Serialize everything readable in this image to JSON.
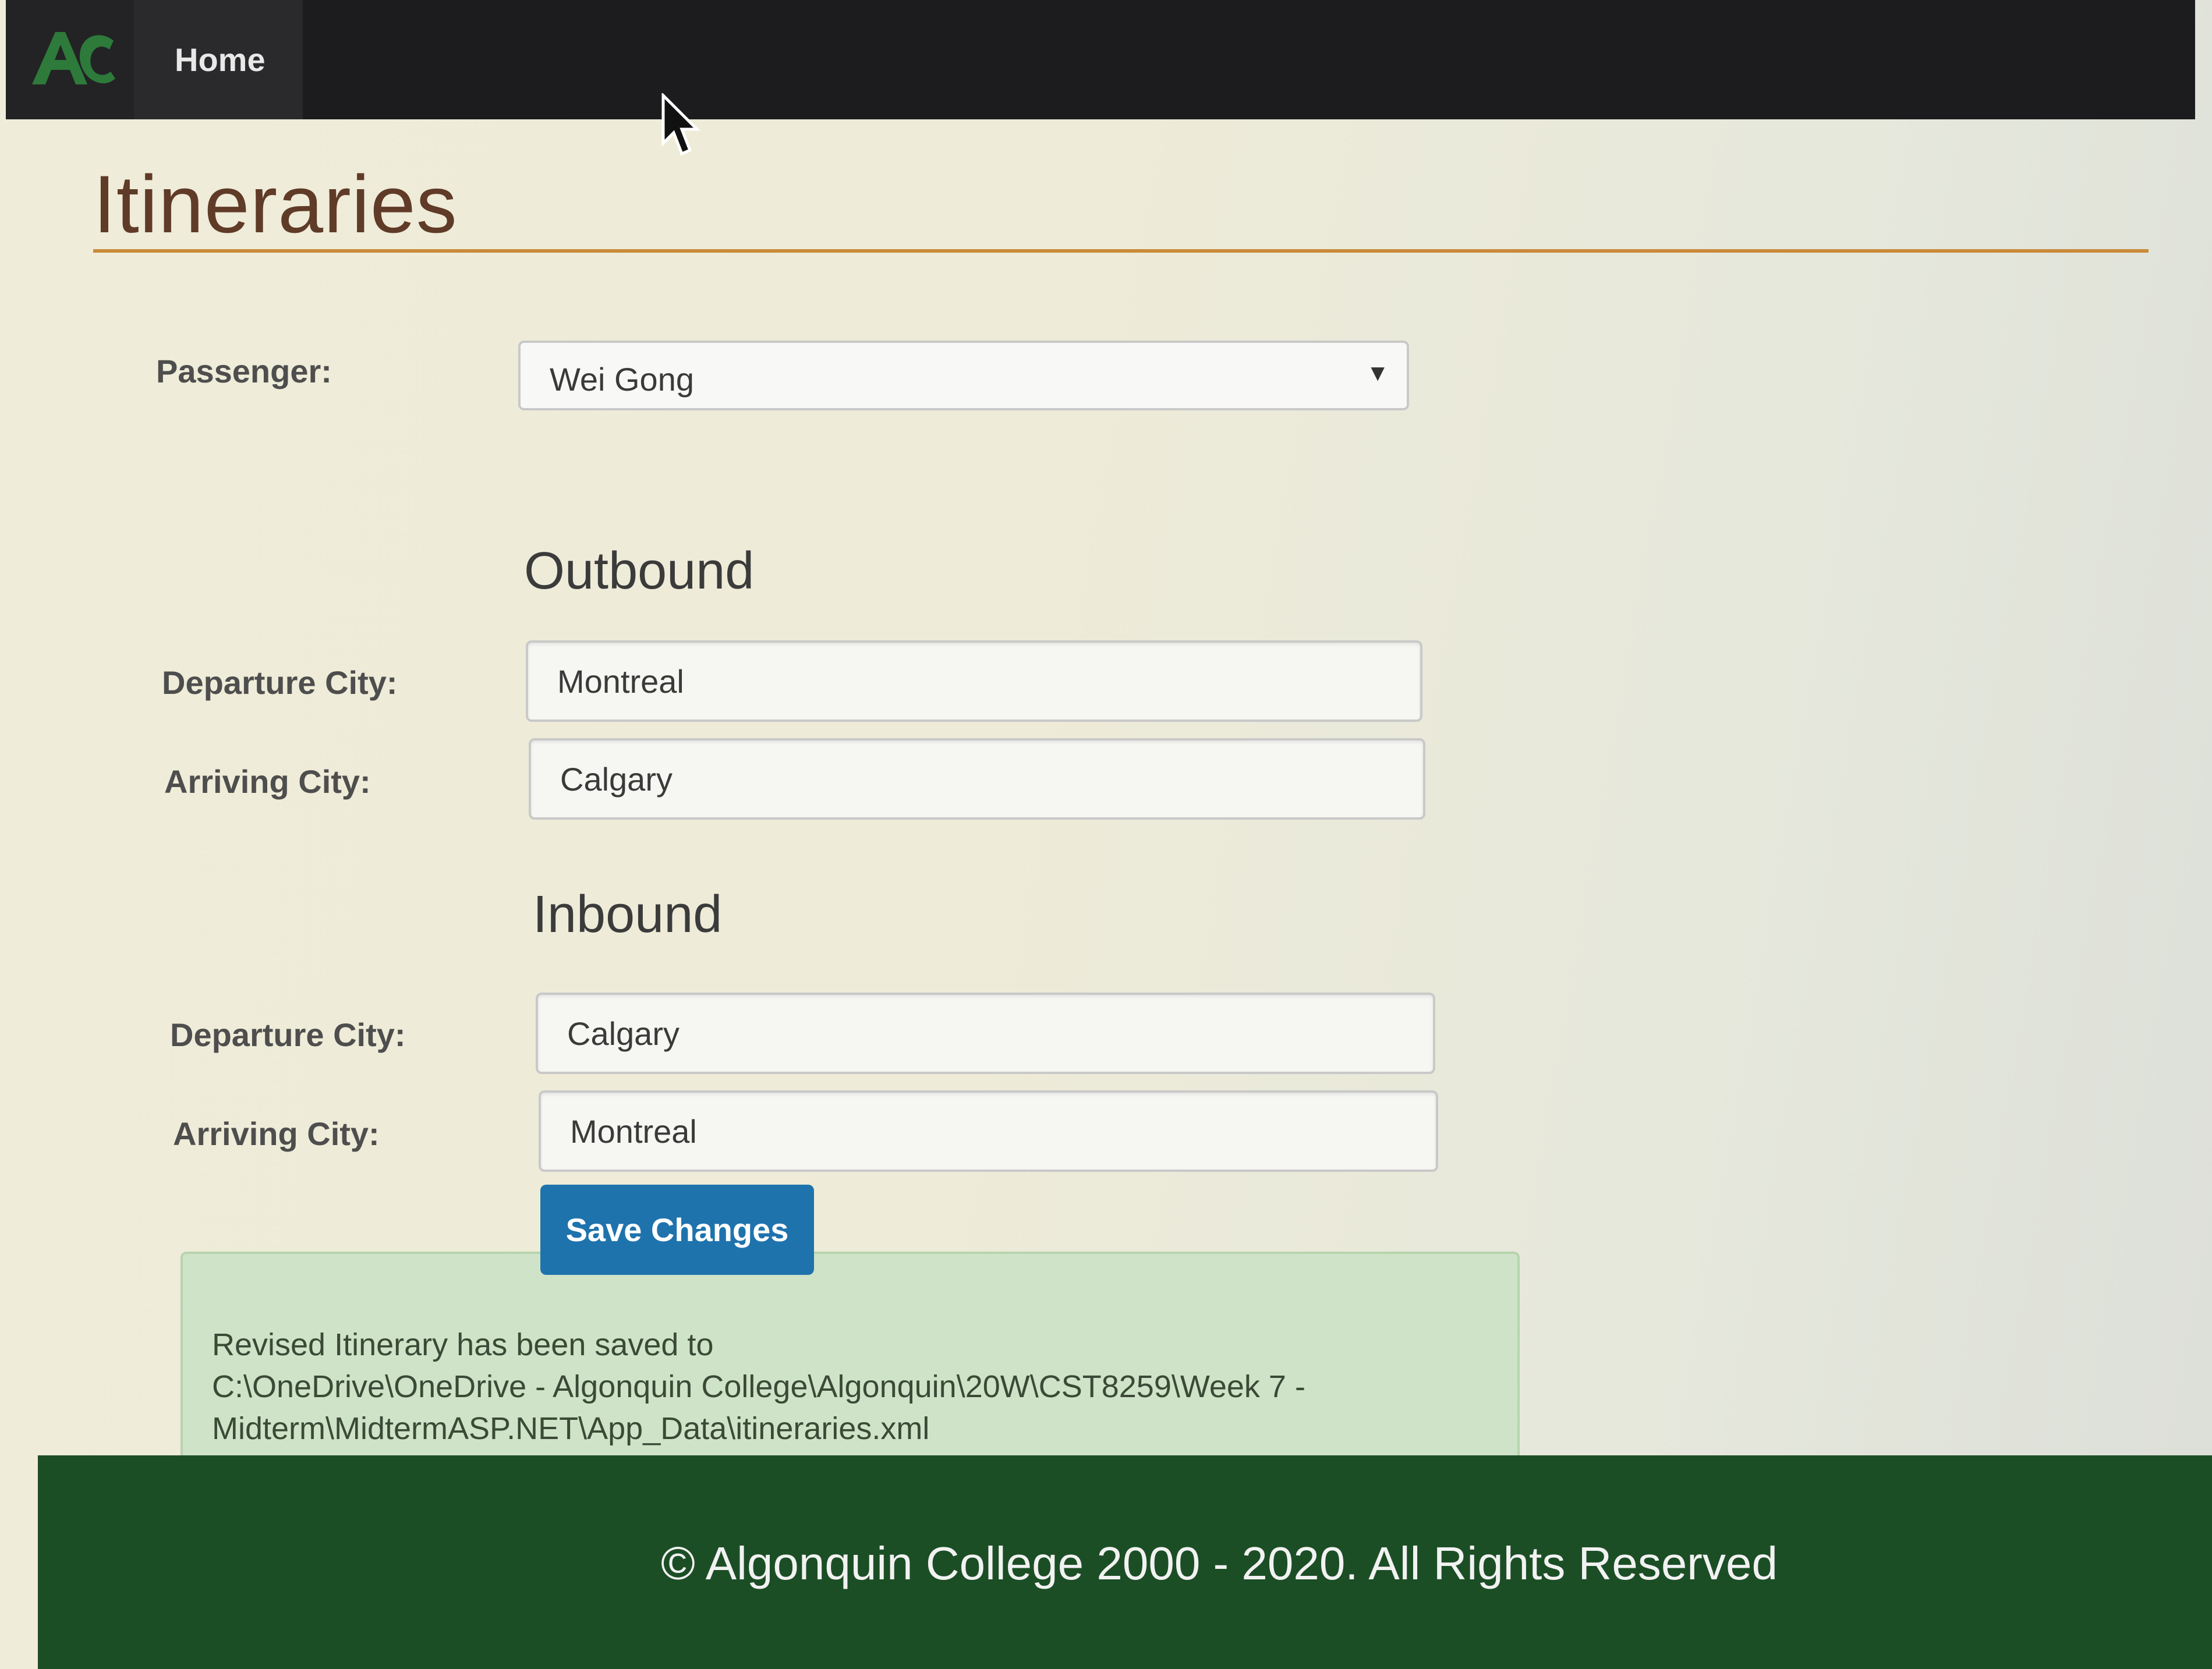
{
  "nav": {
    "logo_icon": "algonquin-college-logo",
    "home_label": "Home",
    "colors": {
      "bar": "#1c1c1e",
      "logo": "#2d7a3a"
    }
  },
  "page": {
    "title": "Itineraries",
    "accent_color": "#c98a3a"
  },
  "form": {
    "passenger_label": "Passenger:",
    "passenger_value": "Wei Gong",
    "outbound": {
      "heading": "Outbound",
      "departure_label": "Departure City:",
      "departure_value": "Montreal",
      "arriving_label": "Arriving City:",
      "arriving_value": "Calgary"
    },
    "inbound": {
      "heading": "Inbound",
      "departure_label": "Departure City:",
      "departure_value": "Calgary",
      "arriving_label": "Arriving City:",
      "arriving_value": "Montreal"
    },
    "save_label": "Save Changes",
    "save_color": "#1f73ad"
  },
  "alert": {
    "line1": "Revised Itinerary has been saved to",
    "line2": "C:\\OneDrive\\OneDrive - Algonquin College\\Algonquin\\20W\\CST8259\\Week 7 -",
    "line3": "Midterm\\MidtermASP.NET\\App_Data\\itineraries.xml",
    "color": "#cfe3c8"
  },
  "footer": {
    "text": "© Algonquin College 2000 - 2020. All Rights Reserved",
    "color": "#1c4e25"
  }
}
